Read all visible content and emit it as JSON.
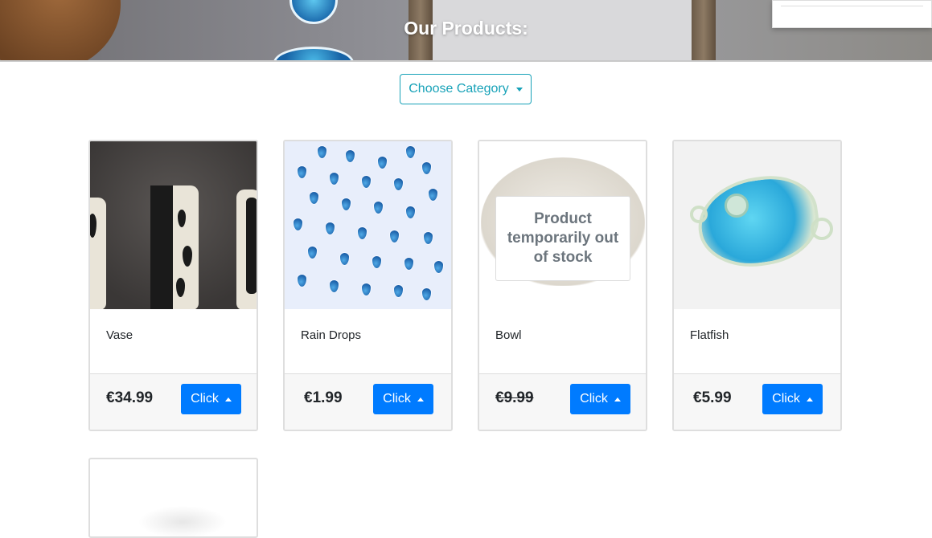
{
  "header": {
    "title": "Our Products:"
  },
  "category_dropdown": {
    "label": "Choose Category"
  },
  "products": [
    {
      "name": "Vase",
      "price": "€34.99",
      "button_label": "Click",
      "in_stock": true
    },
    {
      "name": "Rain Drops",
      "price": "€1.99",
      "button_label": "Click",
      "in_stock": true
    },
    {
      "name": "Bowl",
      "price": "€9.99",
      "button_label": "Click",
      "in_stock": false,
      "stock_message": "Product temporarily out of stock"
    },
    {
      "name": "Flatfish",
      "price": "€5.99",
      "button_label": "Click",
      "in_stock": true
    }
  ],
  "colors": {
    "primary": "#007bff",
    "outline_info": "#17a2b8",
    "card_footer": "#f7f7f7"
  }
}
